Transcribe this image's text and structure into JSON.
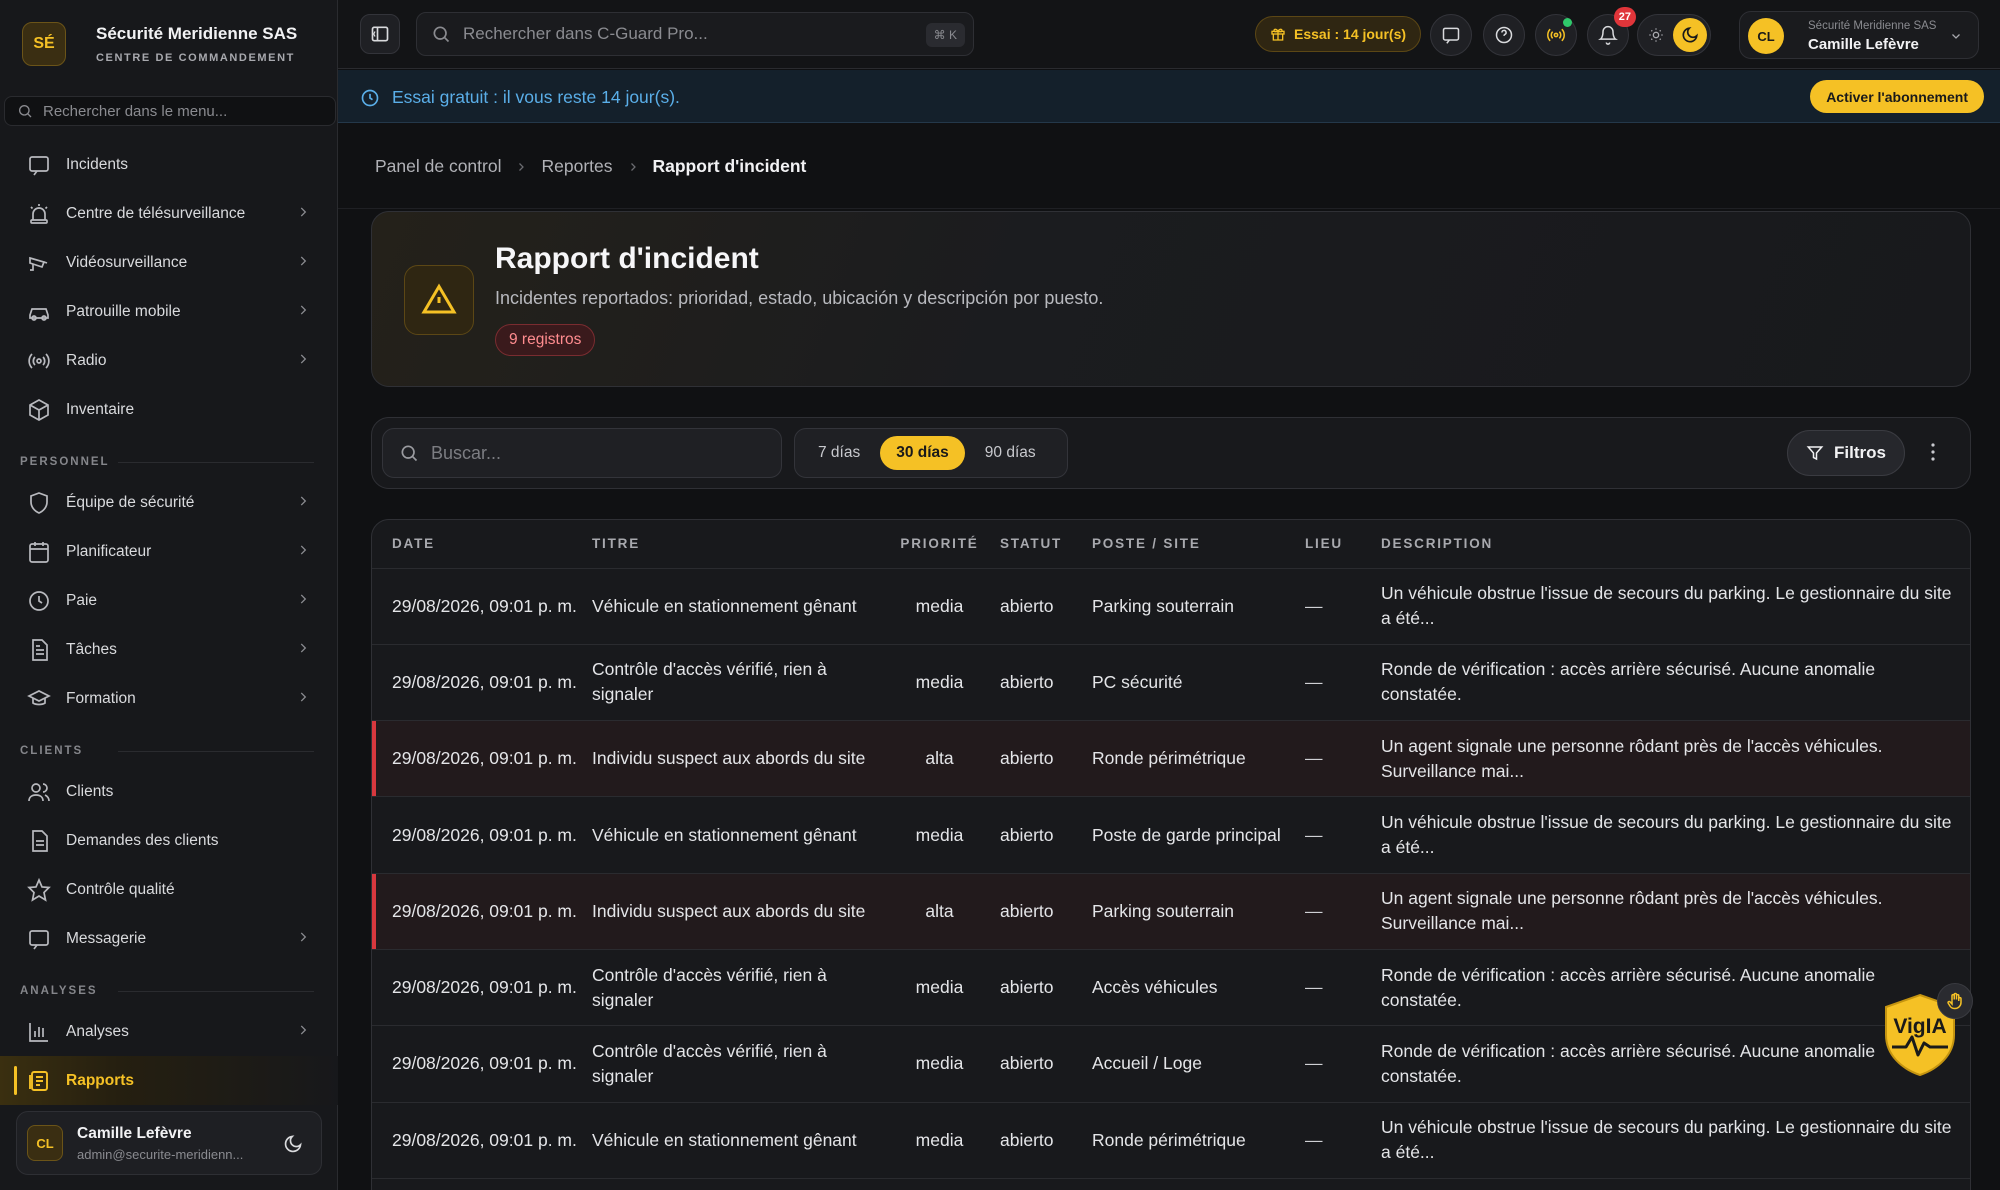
{
  "brand": {
    "initials": "SÉ",
    "name": "Sécurité Meridienne SAS",
    "subtitle": "CENTRE DE COMMANDEMENT"
  },
  "sidebar": {
    "search_placeholder": "Rechercher dans le menu...",
    "items_ops": [
      {
        "label": "Incidents",
        "icon": "incident-icon",
        "has_chevron": false
      },
      {
        "label": "Centre de télésurveillance",
        "icon": "siren-icon",
        "has_chevron": true
      },
      {
        "label": "Vidéosurveillance",
        "icon": "cctv-icon",
        "has_chevron": true
      },
      {
        "label": "Patrouille mobile",
        "icon": "car-icon",
        "has_chevron": true
      },
      {
        "label": "Radio",
        "icon": "radio-icon",
        "has_chevron": true
      },
      {
        "label": "Inventaire",
        "icon": "box-icon",
        "has_chevron": false
      }
    ],
    "section_personnel": "PERSONNEL",
    "items_personnel": [
      {
        "label": "Équipe de sécurité",
        "icon": "shield-icon"
      },
      {
        "label": "Planificateur",
        "icon": "calendar-icon"
      },
      {
        "label": "Paie",
        "icon": "clock-icon"
      },
      {
        "label": "Tâches",
        "icon": "tasks-icon"
      },
      {
        "label": "Formation",
        "icon": "graduation-cap-icon"
      }
    ],
    "section_clients": "CLIENTS",
    "items_clients": [
      {
        "label": "Clients",
        "icon": "users-icon"
      },
      {
        "label": "Demandes des clients",
        "icon": "document-icon"
      },
      {
        "label": "Contrôle qualité",
        "icon": "star-icon"
      },
      {
        "label": "Messagerie",
        "icon": "message-icon"
      }
    ],
    "section_analyses": "ANALYSES",
    "items_analyses": [
      {
        "label": "Analyses",
        "icon": "bar-chart-icon"
      },
      {
        "label": "Rapports",
        "icon": "report-icon",
        "active": true
      }
    ],
    "user": {
      "initials": "CL",
      "name": "Camille Lefèvre",
      "email": "admin@securite-meridienn..."
    }
  },
  "topbar": {
    "search_placeholder": "Rechercher dans C-Guard Pro...",
    "shortcut": "⌘ K",
    "trial_pill": "Essai : 14 jour(s)",
    "notifications_count": "27",
    "account": {
      "initials": "CL",
      "org": "Sécurité Meridienne SAS",
      "name": "Camille Lefèvre"
    }
  },
  "banner": {
    "text": "Essai gratuit : il vous reste 14 jour(s).",
    "cta": "Activer l'abonnement"
  },
  "breadcrumb": [
    "Panel de control",
    "Reportes",
    "Rapport d'incident"
  ],
  "page": {
    "title": "Rapport d'incident",
    "subtitle": "Incidentes reportados: prioridad, estado, ubicación y descripción por puesto.",
    "badge": "9 registros"
  },
  "filters": {
    "search_placeholder": "Buscar...",
    "ranges": [
      "7 días",
      "30 días",
      "90 días"
    ],
    "active_range": "30 días",
    "filters_label": "Filtros"
  },
  "table": {
    "columns": [
      "DATE",
      "TITRE",
      "PRIORITÉ",
      "STATUT",
      "POSTE / SITE",
      "LIEU",
      "DESCRIPTION"
    ],
    "rows": [
      {
        "date": "29/08/2026, 09:01 p. m.",
        "title": "Véhicule en stationnement gênant",
        "priority": "media",
        "status": "abierto",
        "site": "Parking souterrain",
        "lieu": "—",
        "description": "Un véhicule obstrue l'issue de secours du parking. Le gestionnaire du site a été..."
      },
      {
        "date": "29/08/2026, 09:01 p. m.",
        "title": "Contrôle d'accès vérifié, rien à signaler",
        "priority": "media",
        "status": "abierto",
        "site": "PC sécurité",
        "lieu": "—",
        "description": "Ronde de vérification : accès arrière sécurisé. Aucune anomalie constatée."
      },
      {
        "date": "29/08/2026, 09:01 p. m.",
        "title": "Individu suspect aux abords du site",
        "priority": "alta",
        "status": "abierto",
        "site": "Ronde périmétrique",
        "lieu": "—",
        "description": "Un agent signale une personne rôdant près de l'accès véhicules. Surveillance mai..."
      },
      {
        "date": "29/08/2026, 09:01 p. m.",
        "title": "Véhicule en stationnement gênant",
        "priority": "media",
        "status": "abierto",
        "site": "Poste de garde principal",
        "lieu": "—",
        "description": "Un véhicule obstrue l'issue de secours du parking. Le gestionnaire du site a été..."
      },
      {
        "date": "29/08/2026, 09:01 p. m.",
        "title": "Individu suspect aux abords du site",
        "priority": "alta",
        "status": "abierto",
        "site": "Parking souterrain",
        "lieu": "—",
        "description": "Un agent signale une personne rôdant près de l'accès véhicules. Surveillance mai..."
      },
      {
        "date": "29/08/2026, 09:01 p. m.",
        "title": "Contrôle d'accès vérifié, rien à signaler",
        "priority": "media",
        "status": "abierto",
        "site": "Accès véhicules",
        "lieu": "—",
        "description": "Ronde de vérification : accès arrière sécurisé. Aucune anomalie constatée."
      },
      {
        "date": "29/08/2026, 09:01 p. m.",
        "title": "Contrôle d'accès vérifié, rien à signaler",
        "priority": "media",
        "status": "abierto",
        "site": "Accueil / Loge",
        "lieu": "—",
        "description": "Ronde de vérification : accès arrière sécurisé. Aucune anomalie constatée."
      },
      {
        "date": "29/08/2026, 09:01 p. m.",
        "title": "Véhicule en stationnement gênant",
        "priority": "media",
        "status": "abierto",
        "site": "Ronde périmétrique",
        "lieu": "—",
        "description": "Un véhicule obstrue l'issue de secours du parking. Le gestionnaire du site a été..."
      }
    ]
  },
  "assistant": {
    "label": "VigIA"
  },
  "colors": {
    "accent": "#f5c125",
    "danger": "#d8383e",
    "info": "#5aaee8"
  }
}
